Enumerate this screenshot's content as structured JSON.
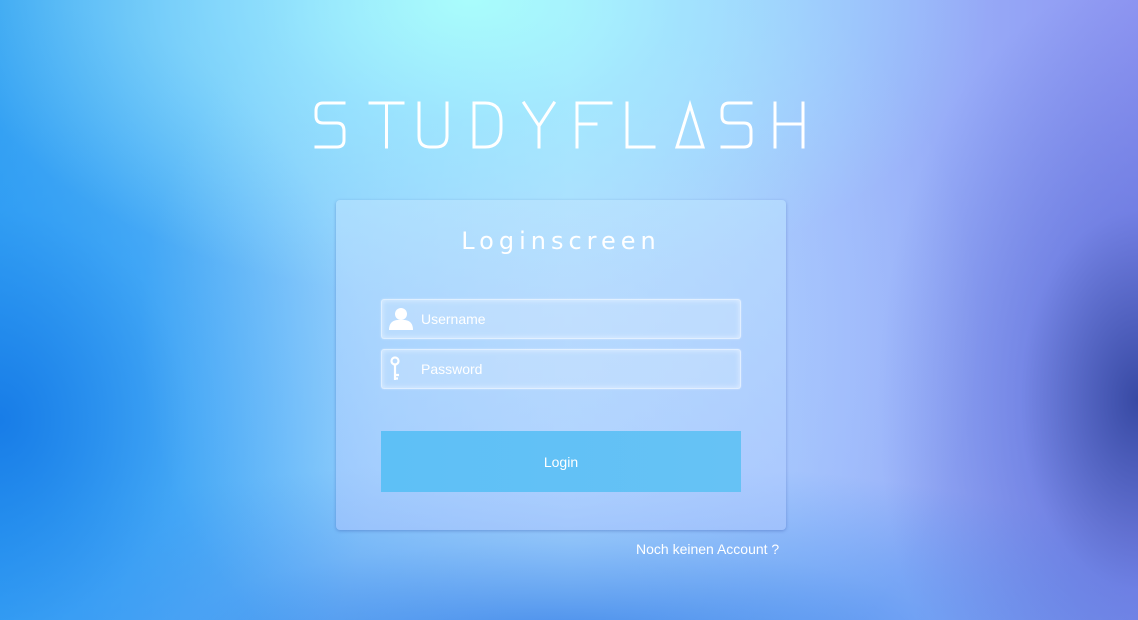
{
  "brand": {
    "logo_text": "STUDYFLASH"
  },
  "login": {
    "title": "Loginscreen",
    "username": {
      "placeholder": "Username",
      "value": "",
      "icon": "user-icon"
    },
    "password": {
      "placeholder": "Password",
      "value": "",
      "icon": "key-icon"
    },
    "submit_label": "Login",
    "register_link": "Noch keinen Account ?"
  },
  "colors": {
    "text": "#ffffff",
    "button": "#5ec0f6"
  }
}
